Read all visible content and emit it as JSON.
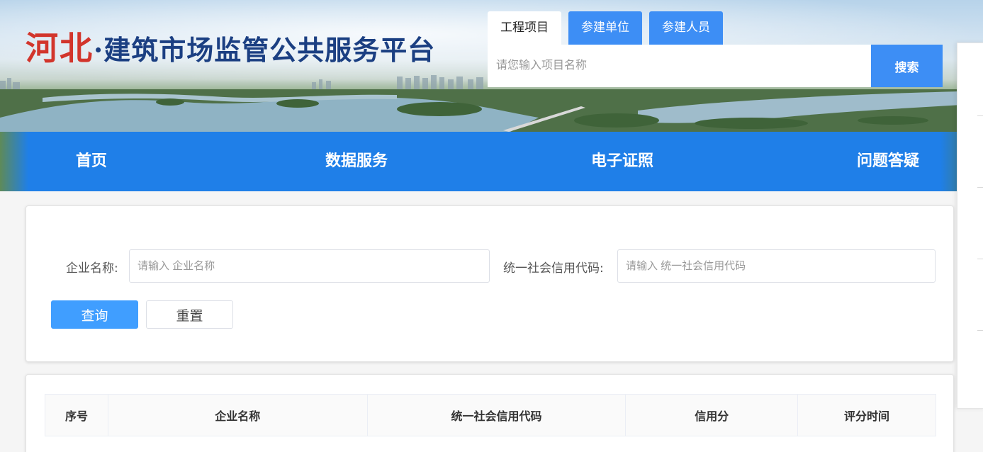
{
  "header": {
    "title_red": "河北",
    "title_blue": "·建筑市场监管公共服务平台"
  },
  "search": {
    "tabs": [
      {
        "label": "工程项目",
        "active": true
      },
      {
        "label": "参建单位",
        "active": false
      },
      {
        "label": "参建人员",
        "active": false
      }
    ],
    "placeholder": "请您输入项目名称",
    "button_label": "搜索"
  },
  "nav": {
    "items": [
      {
        "label": "首页"
      },
      {
        "label": "数据服务"
      },
      {
        "label": "电子证照"
      },
      {
        "label": "问题答疑"
      }
    ]
  },
  "filter": {
    "company_label": "企业名称:",
    "company_placeholder": "请输入 企业名称",
    "credit_code_label": "统一社会信用代码:",
    "credit_code_placeholder": "请输入 统一社会信用代码",
    "query_button": "查询",
    "reset_button": "重置"
  },
  "table": {
    "columns": [
      "序号",
      "企业名称",
      "统一社会信用代码",
      "信用分",
      "评分时间"
    ]
  },
  "colors": {
    "primary": "#409eff",
    "nav_blue": "#1f7fe8",
    "title_red": "#d2352c",
    "title_blue": "#1b3f82"
  }
}
